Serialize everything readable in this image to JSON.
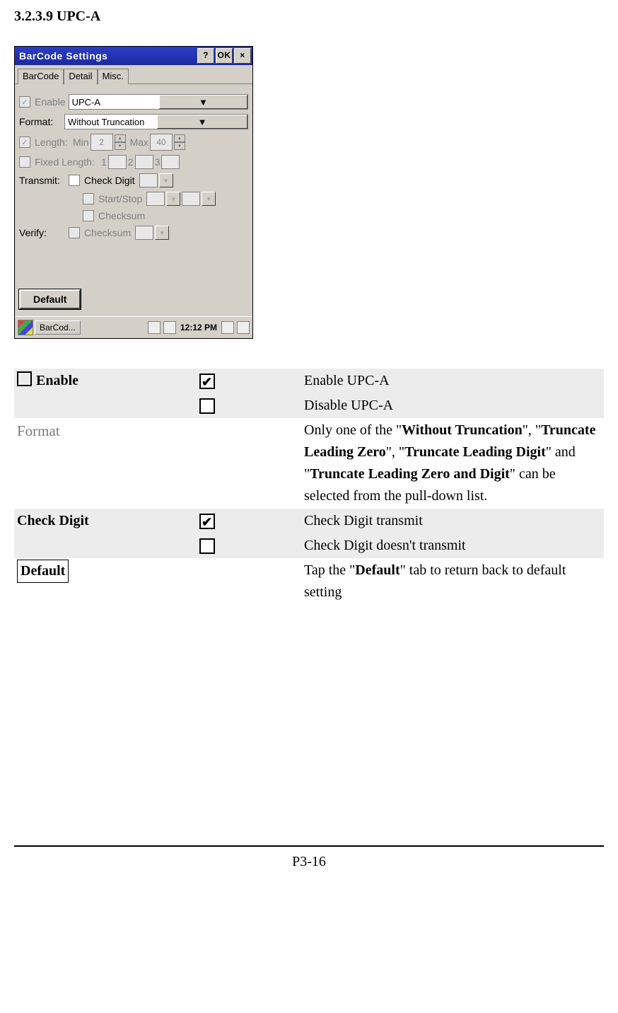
{
  "heading": "3.2.3.9 UPC-A",
  "window": {
    "title": "BarCode Settings",
    "help": "?",
    "ok": "OK",
    "close": "×",
    "tabs": {
      "barcode": "BarCode",
      "detail": "Detail",
      "misc": "Misc."
    },
    "enable_label": "Enable",
    "barcode_value": "UPC-A",
    "format_label": "Format:",
    "format_value": "Without Truncation",
    "length_label": "Length:",
    "min_label": "Min",
    "min_value": "2",
    "max_label": "Max",
    "max_value": "40",
    "fixed_label": "Fixed Length:",
    "fixed_1": "1",
    "fixed_2": "2",
    "fixed_3": "3",
    "transmit_label": "Transmit:",
    "transmit_check": "Check Digit",
    "transmit_start": "Start/Stop",
    "transmit_cks": "Checksum",
    "verify_label": "Verify:",
    "verify_cks": "Checksum",
    "default_btn": "Default",
    "task_app": "BarCod...",
    "clock": "12:12 PM"
  },
  "table": {
    "enable_label": "Enable",
    "enable_on": "Enable UPC-A",
    "enable_off": "Disable UPC-A",
    "format_label": "Format",
    "format_desc_1": "Only one of the \"",
    "format_b1": "Without Truncation",
    "format_desc_2": "\", \"",
    "format_b2": "Truncate Leading Zero",
    "format_desc_3": "\", \"",
    "format_b3": "Truncate Leading Digit",
    "format_desc_4": "\" and \"",
    "format_b4": "Truncate Leading Zero and Digit",
    "format_desc_5": "\" can be selected from the pull-down list.",
    "check_label": "Check Digit",
    "check_on": "Check Digit transmit",
    "check_off": "Check Digit doesn't transmit",
    "default_label": "Default",
    "default_desc_1": "Tap the \"",
    "default_b": "Default",
    "default_desc_2": "\" tab to return back to default setting"
  },
  "page": "P3-16"
}
